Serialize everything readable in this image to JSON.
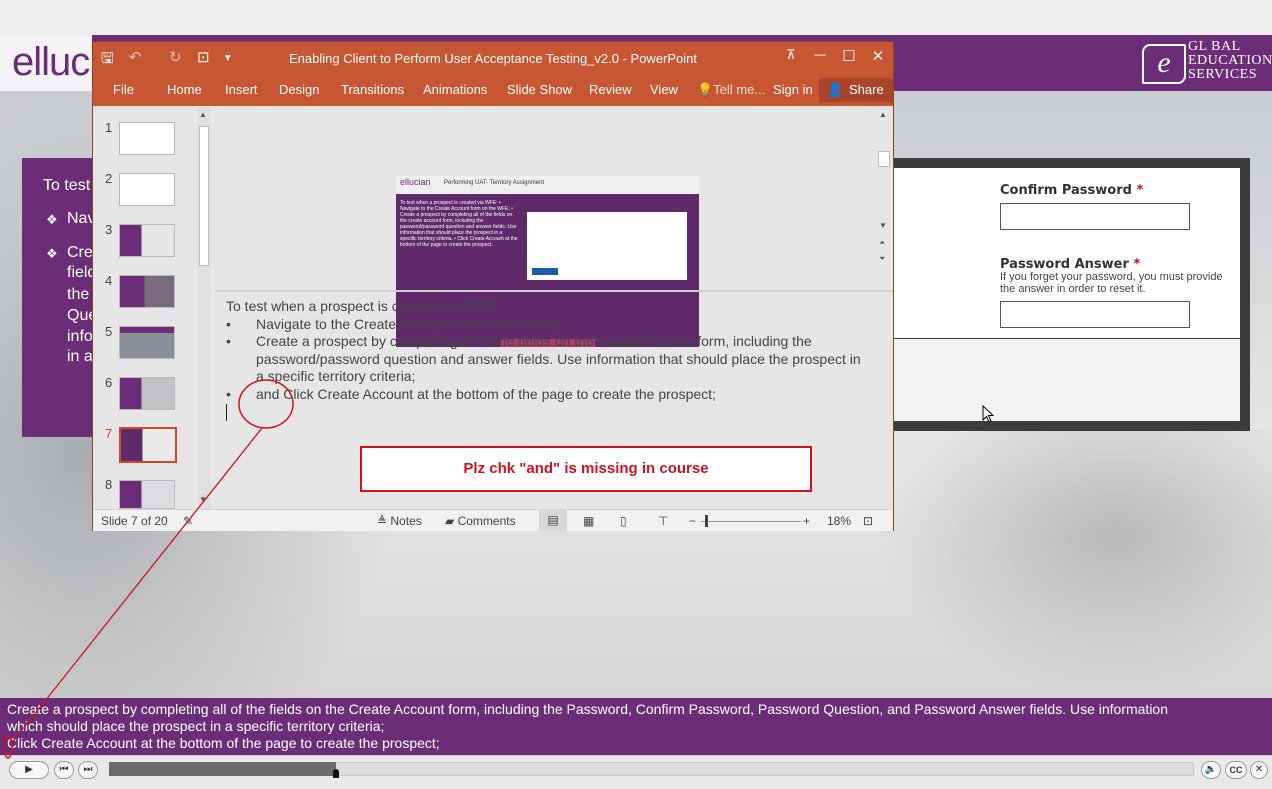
{
  "course": {
    "logo_text": "elluc",
    "ges_logo": {
      "mark": "e",
      "lines": [
        "GL BAL",
        "EDUCATION",
        "SERVICES"
      ]
    },
    "purple_panel": {
      "lines": [
        "To test",
        "Nav",
        "Cre",
        "field",
        "the",
        "Que",
        "info",
        "in a"
      ]
    },
    "form": {
      "confirm_password_label": "Confirm Password",
      "password_answer_label": "Password Answer",
      "required_mark": "*",
      "password_answer_help": "If you forget your password, you must provide the answer in order to reset it."
    },
    "caption_lines": [
      "Create a prospect by completing all of the fields on the Create Account form, including the Password, Confirm Password, Password Question, and Password Answer fields. Use information",
      "which should place the prospect in a specific territory criteria;",
      "Click Create Account at the bottom of the page to create the prospect;"
    ],
    "player": {
      "play": "▶",
      "prev": "⏮",
      "next": "⏭",
      "volume": "🔈",
      "cc": "CC",
      "close": "✕",
      "progress": 0.209
    }
  },
  "ppt": {
    "title": "Enabling Client to Perform User Acceptance Testing_v2.0 - PowerPoint",
    "qat": {
      "save": "🖫",
      "undo": "↶",
      "redo": "↻",
      "present": "⊡",
      "more": "▾"
    },
    "window": {
      "ribbon_opts": "⊼",
      "minimize": "—",
      "maximize": "☐",
      "close": "✕"
    },
    "tabs": [
      "File",
      "Home",
      "Insert",
      "Design",
      "Transitions",
      "Animations",
      "Slide Show",
      "Review",
      "View"
    ],
    "tell_me": "Tell me...",
    "sign_in": "Sign in",
    "share": "Share",
    "thumbnails": [
      "1",
      "2",
      "3",
      "4",
      "5",
      "6",
      "7",
      "8"
    ],
    "selected_slide": "7",
    "slide_preview": {
      "logo": "ellucian",
      "heading": "Performing UAT- Territory Assignment",
      "left_text": "To test when a prospect is created via WFE: • Navigate to the Create Account form on the WFE; • Create a prospect by completing all of the fields on the create account form, including the password/password question and answer fields. Use information that should place the prospect in a specific territory criteria. • Click Create Account at the bottom of the page to create the prospect."
    },
    "notes": {
      "intro": "To test when a prospect is created via WFE:",
      "bullets": [
        "Navigate to the Create Account form on the WFE;",
        "Create a prospect by completing all of the fields on the Create Account form, including the password/password question and answer fields. Use information that should place the prospect in a specific territory criteria;",
        "and Click Create Account at the bottom of the page to create the prospect;"
      ],
      "bullet_char": "•"
    },
    "status": {
      "slide_counter": "Slide 7 of 20",
      "notes": "Notes",
      "comments": "Comments",
      "zoom": "18%"
    }
  },
  "annotation": {
    "message": "Plz chk \"and\" is missing in course",
    "color": "#d0121b"
  }
}
